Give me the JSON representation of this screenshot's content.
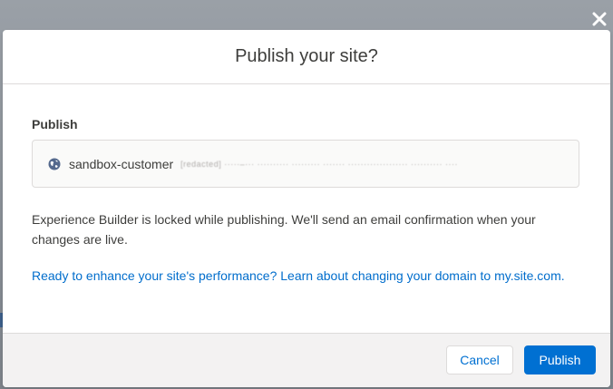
{
  "modal": {
    "title": "Publish your site?",
    "section_label": "Publish",
    "site": {
      "name": "sandbox-customer",
      "url": "[redacted] ·····–··· ·········· ········· ······· ··················· ·········· ····"
    },
    "info_text": "Experience Builder is locked while publishing. We'll send an email confirmation when your changes are live.",
    "promo_link": "Ready to enhance your site's performance? Learn about changing your domain to my.site.com.",
    "buttons": {
      "cancel": "Cancel",
      "publish": "Publish"
    }
  },
  "icons": {
    "close": "close-icon",
    "globe": "globe-icon"
  },
  "colors": {
    "accent": "#0070d2",
    "link": "#006dcc",
    "text": "#3e3e3c",
    "footer_bg": "#f3f2f2"
  }
}
